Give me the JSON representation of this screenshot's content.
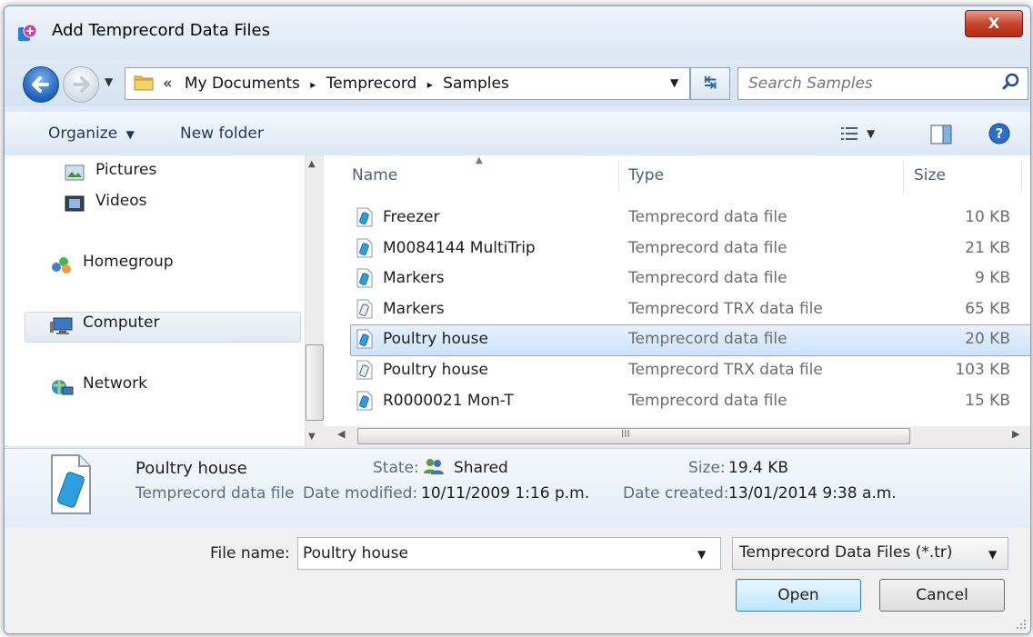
{
  "window": {
    "title": "Add Temprecord Data Files",
    "close_label": "X"
  },
  "address": {
    "prefix": "«",
    "crumbs": [
      "My Documents",
      "Temprecord",
      "Samples"
    ],
    "sep": "▸"
  },
  "search": {
    "placeholder": "Search Samples"
  },
  "toolbar": {
    "organize": "Organize",
    "new_folder": "New folder"
  },
  "nav_pane": {
    "items": [
      "Pictures",
      "Videos",
      "Homegroup",
      "Computer",
      "Network"
    ],
    "selected": "Computer"
  },
  "file_list": {
    "columns": {
      "name": "Name",
      "type": "Type",
      "size": "Size"
    },
    "rows": [
      {
        "name": "Freezer",
        "type": "Temprecord data file",
        "size": "10 KB",
        "icon": "tr-file-icon"
      },
      {
        "name": "M0084144 MultiTrip",
        "type": "Temprecord data file",
        "size": "21 KB",
        "icon": "tr-file-icon"
      },
      {
        "name": "Markers",
        "type": "Temprecord data file",
        "size": "9 KB",
        "icon": "tr-file-icon"
      },
      {
        "name": "Markers",
        "type": "Temprecord TRX data file",
        "size": "65 KB",
        "icon": "trx-file-icon"
      },
      {
        "name": "Poultry house",
        "type": "Temprecord data file",
        "size": "20 KB",
        "icon": "tr-file-icon",
        "selected": true
      },
      {
        "name": "Poultry house",
        "type": "Temprecord TRX data file",
        "size": "103 KB",
        "icon": "trx-file-icon"
      },
      {
        "name": "R0000021 Mon-T",
        "type": "Temprecord data file",
        "size": "15 KB",
        "icon": "tr-file-icon"
      }
    ],
    "hscroll_glyph": "III"
  },
  "details": {
    "name": "Poultry house",
    "type": "Temprecord data file",
    "state_label": "State:",
    "state_value": "Shared",
    "size_label": "Size:",
    "size_value": "19.4 KB",
    "modified_label": "Date modified:",
    "modified_value": "10/11/2009 1:16 p.m.",
    "created_label": "Date created:",
    "created_value": "13/01/2014 9:38 a.m."
  },
  "footer": {
    "file_name_label": "File name:",
    "file_name_value": "Poultry house",
    "filter_value": "Temprecord Data Files (*.tr)",
    "open_label": "Open",
    "cancel_label": "Cancel"
  }
}
